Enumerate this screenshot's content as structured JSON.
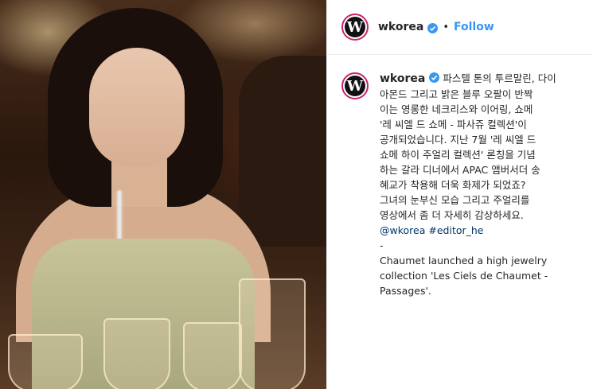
{
  "post": {
    "username": "wkorea",
    "follow_label": "Follow",
    "dot": "•",
    "avatar_letter": "W"
  },
  "caption": {
    "lines": [
      "파스텔 톤의 투르말린, 다이",
      "아몬드 그리고 밝은 블루 오팔이 반짝",
      "이는 영롱한 네크리스와 이어링, 쇼메",
      "'레 씨엘 드 쇼메 - 파사쥬 컬렉션'이",
      "공개되었습니다. 지난 7월 '레 씨엘 드",
      "쇼메 하이 주얼리 컬렉션' 론칭을 기념",
      "하는 갈라 디너에서 APAC 앰버서더 송",
      "혜교가 착용해 더욱 화제가 되었죠?",
      "그녀의 눈부신 모습 그리고 주얼리를",
      "영상에서 좀 더 자세히 감상하세요."
    ],
    "mention": "@wkorea",
    "hashtag": "#editor_he",
    "dash": "-",
    "english_lines": [
      "Chaumet launched a high jewelry",
      "collection 'Les Ciels de Chaumet -",
      "Passages'."
    ]
  },
  "colors": {
    "link": "#3897f0",
    "hashtag": "#003569",
    "text": "#262626"
  }
}
